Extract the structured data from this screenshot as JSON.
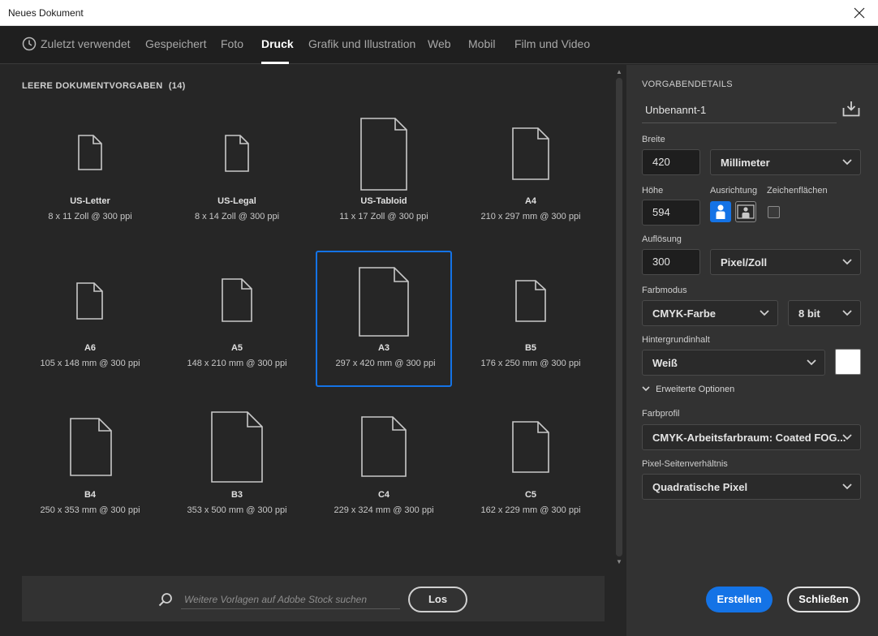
{
  "window": {
    "title": "Neues Dokument"
  },
  "tabs": [
    {
      "label": "Zuletzt verwendet"
    },
    {
      "label": "Gespeichert"
    },
    {
      "label": "Foto"
    },
    {
      "label": "Druck"
    },
    {
      "label": "Grafik und Illustration"
    },
    {
      "label": "Web"
    },
    {
      "label": "Mobil"
    },
    {
      "label": "Film und Video"
    }
  ],
  "active_tab": "Druck",
  "section": {
    "title": "LEERE DOKUMENTVORGABEN",
    "count": "(14)"
  },
  "presets": [
    {
      "name": "US-Letter",
      "dims": "8 x 11 Zoll @ 300 ppi"
    },
    {
      "name": "US-Legal",
      "dims": "8 x 14 Zoll @ 300 ppi"
    },
    {
      "name": "US-Tabloid",
      "dims": "11 x 17 Zoll @ 300 ppi"
    },
    {
      "name": "A4",
      "dims": "210 x 297 mm @ 300 ppi"
    },
    {
      "name": "A6",
      "dims": "105 x 148 mm @ 300 ppi"
    },
    {
      "name": "A5",
      "dims": "148 x 210 mm @ 300 ppi"
    },
    {
      "name": "A3",
      "dims": "297 x 420 mm @ 300 ppi"
    },
    {
      "name": "B5",
      "dims": "176 x 250 mm @ 300 ppi"
    },
    {
      "name": "B4",
      "dims": "250 x 353 mm @ 300 ppi"
    },
    {
      "name": "B3",
      "dims": "353 x 500 mm @ 300 ppi"
    },
    {
      "name": "C4",
      "dims": "229 x 324 mm @ 300 ppi"
    },
    {
      "name": "C5",
      "dims": "162 x 229 mm @ 300 ppi"
    }
  ],
  "selected_preset": "A3",
  "search": {
    "placeholder": "Weitere Vorlagen auf Adobe Stock suchen",
    "value": "",
    "button": "Los"
  },
  "details": {
    "heading": "VORGABENDETAILS",
    "doc_name": "Unbenannt-1",
    "width_label": "Breite",
    "width_value": "420",
    "width_unit": "Millimeter",
    "height_label": "Höhe",
    "height_value": "594",
    "orientation_label": "Ausrichtung",
    "orientation": "portrait",
    "artboards_label": "Zeichenflächen",
    "artboards_checked": false,
    "resolution_label": "Auflösung",
    "resolution_value": "300",
    "resolution_unit": "Pixel/Zoll",
    "color_mode_label": "Farbmodus",
    "color_mode": "CMYK-Farbe",
    "bit_depth": "8 bit",
    "background_label": "Hintergrundinhalt",
    "background": "Weiß",
    "background_color": "#ffffff",
    "advanced_label": "Erweiterte Optionen",
    "color_profile_label": "Farbprofil",
    "color_profile": "CMYK-Arbeitsfarbraum: Coated FOG...",
    "pixel_aspect_label": "Pixel-Seitenverhältnis",
    "pixel_aspect": "Quadratische Pixel"
  },
  "buttons": {
    "create": "Erstellen",
    "close": "Schließen"
  },
  "colors": {
    "accent": "#1473e6",
    "panel": "#323232",
    "background": "#262626"
  }
}
